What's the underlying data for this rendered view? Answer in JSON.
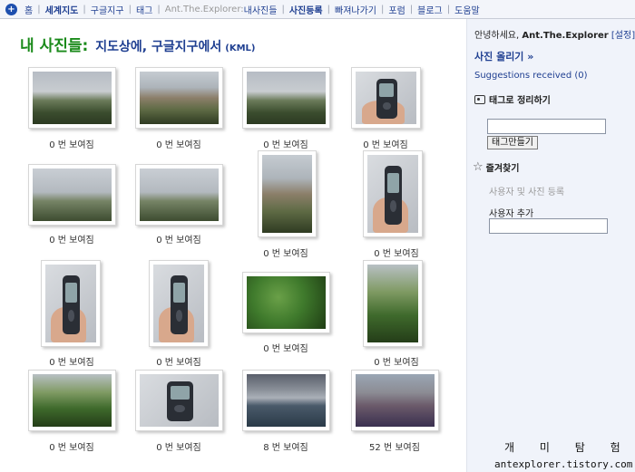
{
  "nav": {
    "home": "홈",
    "world_map": "세계지도",
    "google_earth": "구글지구",
    "tags": "태그",
    "user_label": "Ant.The.Explorer:",
    "my_photos": "내사진들",
    "upload": "사진등록",
    "exit": "빠져나가기",
    "forum": "포럼",
    "blog": "블로그",
    "help": "도움말"
  },
  "title": {
    "main": "내 사진들:",
    "sub": "지도상에, 구글지구에서",
    "kml": "(KML)"
  },
  "photos": [
    {
      "views": "0 번 보여짐"
    },
    {
      "views": "0 번 보여짐"
    },
    {
      "views": "0 번 보여짐"
    },
    {
      "views": "0 번 보여짐"
    },
    {
      "views": "0 번 보여짐"
    },
    {
      "views": "0 번 보여짐"
    },
    {
      "views": "0 번 보여짐"
    },
    {
      "views": "0 번 보여짐"
    },
    {
      "views": "0 번 보여짐"
    },
    {
      "views": "0 번 보여짐"
    },
    {
      "views": "0 번 보여짐"
    },
    {
      "views": "0 번 보여짐"
    },
    {
      "views": "0 번 보여짐"
    },
    {
      "views": "0 번 보여짐"
    },
    {
      "views": "8 번 보여짐"
    },
    {
      "views": "52 번 보여짐"
    }
  ],
  "sidebar": {
    "greeting": "안녕하세요,",
    "username": "Ant.The.Explorer",
    "settings": "[설정]",
    "upload_link": "사진 올리기 »",
    "suggestions": "Suggestions received (0)",
    "tag_section": "태그로 정리하기",
    "tag_button": "태그만들기",
    "favorites_section": "즐겨찾기",
    "users_and_photos": "사용자 및 사진 등록",
    "add_user": "사용자 추가"
  },
  "watermark": "개 미 탐 험 가",
  "footer_url": "antexplorer.tistory.com"
}
